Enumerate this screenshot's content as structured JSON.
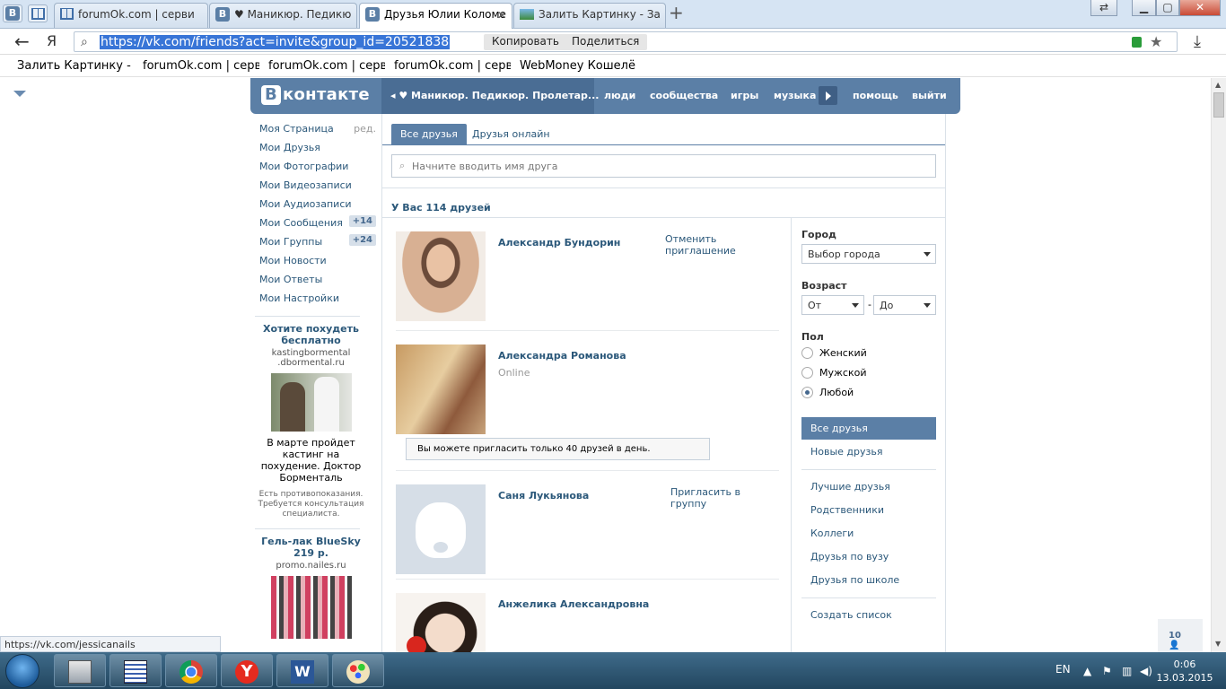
{
  "browser": {
    "tabs": [
      {
        "label": "forumOk.com | серви",
        "icon": "book-icon"
      },
      {
        "label": "♥ Маникюр. Педикю",
        "icon": "vk-icon"
      },
      {
        "label": "Друзья Юлии Коломе",
        "icon": "vk-icon",
        "active": true
      },
      {
        "label": "Залить Картинку - За",
        "icon": "image-icon"
      }
    ],
    "pinned": [
      "vk-icon",
      "book-icon"
    ],
    "window_buttons": [
      "restore",
      "minimize",
      "maximize",
      "close"
    ],
    "url": "https://vk.com/friends?act=invite&group_id=20521838",
    "copy_label": "Копировать",
    "share_label": "Поделиться",
    "yandex_label": "Я",
    "bookmarks": [
      "Залить Картинку - З",
      "forumOk.com | серв",
      "forumOk.com | серв",
      "forumOk.com | серв",
      "WebMoney Кошелё"
    ]
  },
  "vk": {
    "logo": "контакте",
    "logo_letter": "В",
    "group_tab": "♥ Маникюр. Педикюр. Пролетар...",
    "nav": [
      "люди",
      "сообщества",
      "игры",
      "музыка",
      "помощь",
      "выйти"
    ],
    "left_menu": [
      {
        "label": "Моя Страница",
        "extra": "ред."
      },
      {
        "label": "Мои Друзья"
      },
      {
        "label": "Мои Фотографии"
      },
      {
        "label": "Мои Видеозаписи"
      },
      {
        "label": "Мои Аудиозаписи"
      },
      {
        "label": "Мои Сообщения",
        "count": "+14"
      },
      {
        "label": "Мои Группы",
        "count": "+24"
      },
      {
        "label": "Мои Новости"
      },
      {
        "label": "Мои Ответы"
      },
      {
        "label": "Мои Настройки"
      }
    ],
    "ads": [
      {
        "title": "Хотите похудеть бесплатно",
        "site": "kastingbormental .dbormental.ru",
        "text": "В марте пройдет кастинг на похудение. Доктор Борменталь",
        "note": "Есть противопоказания. Требуется консультация специалиста."
      },
      {
        "title": "Гель-лак BlueSky 219 р.",
        "site": "promo.nailes.ru"
      }
    ],
    "tabs": {
      "all": "Все друзья",
      "online": "Друзья онлайн"
    },
    "search_placeholder": "Начните вводить имя друга",
    "friends_count": "У Вас 114 друзей",
    "friends": [
      {
        "name": "Александр Бундорин",
        "action": "Отменить приглашение"
      },
      {
        "name": "Александра Романова",
        "status": "Online"
      },
      {
        "name": "Саня Лукьянова",
        "action": "Пригласить в группу"
      },
      {
        "name": "Анжелика Александровна"
      }
    ],
    "notice": "Вы можете пригласить только 40 друзей в день.",
    "filter": {
      "city_label": "Город",
      "city_value": "Выбор города",
      "age_label": "Возраст",
      "age_from": "От",
      "age_dash": "-",
      "age_to": "До",
      "sex_label": "Пол",
      "sex_options": [
        "Женский",
        "Мужской",
        "Любой"
      ],
      "sex_selected": "Любой",
      "menu": [
        "Все друзья",
        "Новые друзья",
        "Лучшие друзья",
        "Родственники",
        "Коллеги",
        "Друзья по вузу",
        "Друзья по школе",
        "Создать список"
      ]
    },
    "counter": "10"
  },
  "status_url": "https://vk.com/jessicanails",
  "taskbar": {
    "apps": [
      "calculator-icon",
      "notepad-icon",
      "chrome-icon",
      "yandex-browser-icon",
      "word-icon",
      "paint-icon"
    ],
    "lang": "EN",
    "time": "0:06",
    "date": "13.03.2015"
  },
  "colors": {
    "vk_blue": "#5b7fa6",
    "link": "#2b587a"
  }
}
